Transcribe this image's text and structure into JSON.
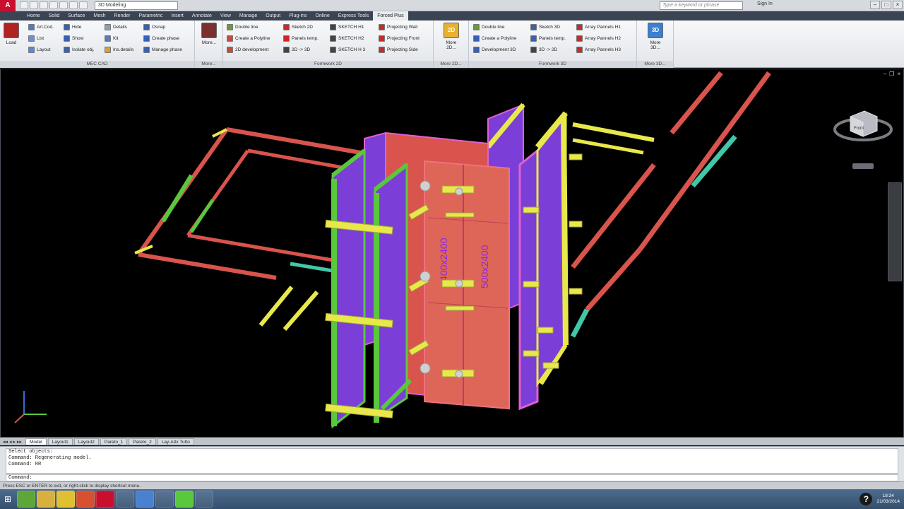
{
  "app": {
    "logo": "A",
    "workspace": "3D Modeling",
    "search_placeholder": "Type a keyword or phrase",
    "signin": "Sign In"
  },
  "menu": {
    "tabs": [
      "Home",
      "Solid",
      "Surface",
      "Mesh",
      "Render",
      "Parametric",
      "Insert",
      "Annotate",
      "View",
      "Manage",
      "Output",
      "Plug-ins",
      "Online",
      "Express Tools",
      "Forced Plus"
    ],
    "active": "Forced Plus"
  },
  "ribbon": {
    "mec": {
      "title": "MEC CAD",
      "load": "Load",
      "col1": [
        "Art.Cod.",
        "List",
        "Layout"
      ],
      "col2": [
        "Hide",
        "Show",
        "Isolate obj."
      ],
      "col3": [
        "Details",
        "Kit",
        "Ins.details"
      ],
      "col4": [
        "Osnap",
        "Create phase",
        "Manage phase"
      ]
    },
    "more1": {
      "label": "More...",
      "title": "More..."
    },
    "f2d": {
      "title": "Formwork 2D",
      "col1": [
        "Double line",
        "Create a Polyline",
        "2D development"
      ],
      "col2": [
        "Sketch 2D",
        "Panels temp.",
        "2D -> 3D"
      ],
      "col3": [
        "SKETCH H1",
        "SKETCH H2",
        "SKETCH H 3"
      ],
      "col4": [
        "Projecting Wall",
        "Projecting Front",
        "Projecting Side"
      ]
    },
    "more2d": {
      "label": "More 2D...",
      "title": "More 2D...",
      "icon_text": "2D"
    },
    "f3d": {
      "title": "Formwork 3D",
      "col1": [
        "Double line",
        "Create a Polyline",
        "Development 3D"
      ],
      "col2": [
        "Sketch 3D",
        "Panels temp.",
        "3D -> 2D"
      ],
      "col3": [
        "Array Pannels H1",
        "Array Pannels H2",
        "Array Pannels H3"
      ]
    },
    "more3d": {
      "label": "More 3D...",
      "title": "More 3D...",
      "icon_text": "3D"
    }
  },
  "viewport": {
    "viewcube_label": "Front",
    "panel_texts": [
      "400x2400",
      "500x2400"
    ]
  },
  "layout_tabs": [
    "Model",
    "Layout1",
    "Layout2",
    "Pareto_1",
    "Pareto_2",
    "Lay-A3x Tutto"
  ],
  "command": {
    "lines": [
      "Select objects:",
      "Command:  Regenerating model.",
      "Command: RR"
    ],
    "prompt": "Command:"
  },
  "status": {
    "text": "Press ESC or ENTER to exit, or right-click to display shortcut menu."
  },
  "clock": {
    "time": "18:34",
    "date": "21/03/2014"
  },
  "colors": {
    "ribbon_bg": "#eef0f3",
    "menubar": "#3b4452",
    "purple": "#8a2be2",
    "green": "#5ac83c",
    "yellow": "#e8e84a",
    "red": "#d8544c",
    "pink": "#e060d0"
  }
}
